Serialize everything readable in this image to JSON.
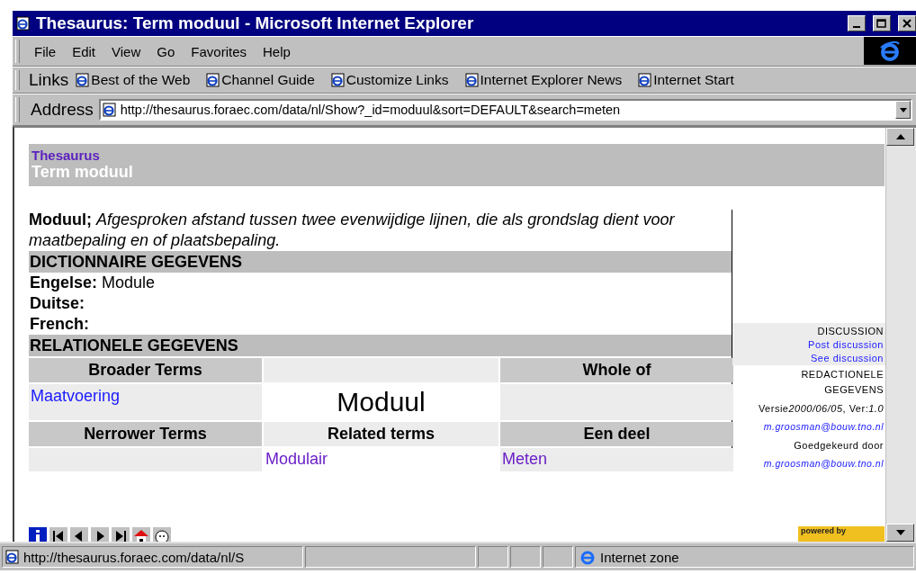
{
  "window": {
    "title": "Thesaurus: Term moduul - Microsoft Internet Explorer"
  },
  "menu": [
    "File",
    "Edit",
    "View",
    "Go",
    "Favorites",
    "Help"
  ],
  "links_bar": {
    "label": "Links",
    "items": [
      "Best of the Web",
      "Channel Guide",
      "Customize Links",
      "Internet Explorer News",
      "Internet Start"
    ]
  },
  "address_bar": {
    "label": "Address",
    "value": "http://thesaurus.foraec.com/data/nl/Show?_id=moduul&sort=DEFAULT&search=meten"
  },
  "page": {
    "header": {
      "section": "Thesaurus",
      "title": "Term moduul"
    },
    "definition": "**Moduul;** *Afgesproken afstand tussen twee evenwijdige lijnen, die als grondslag dient voor maatbepaling en of plaatsbepaling.*",
    "dictionary": {
      "heading": "DICTIONNAIRE GEGEVENS",
      "entries": [
        {
          "label": "Engelse:",
          "value": "Module"
        },
        {
          "label": "Duitse:"
        },
        {
          "label": "French:"
        }
      ]
    },
    "relations": {
      "heading": "RELATIONELE GEGEVENS",
      "broader_heading": "Broader Terms",
      "broader": [
        {
          "text": "Maatvoering",
          "visited": false
        }
      ],
      "whole_of_heading": "Whole of",
      "term": "Moduul",
      "narrower_heading": "Nerrower Terms",
      "related_heading": "Related terms",
      "related": [
        {
          "text": "Modulair",
          "visited": true
        }
      ],
      "part_heading": "Een deel",
      "parts": [
        {
          "text": "Meten",
          "visited": true
        }
      ]
    },
    "sidebar": {
      "discussion_heading": "DISCUSSION",
      "discussion_links": [
        "Post discussion",
        "See discussion"
      ],
      "editorial_heading": "REDACTIONELE GEGEVENS",
      "version": {
        "label": "Versie",
        "date": "2000/06/05",
        "ver_label": ", Ver:",
        "ver": "1.0"
      },
      "author": "m.groosman@bouw.tno.nl",
      "approved_label": "Goedgekeurd door",
      "approver": "m.groosman@bouw.tno.nl"
    },
    "badge": "powered by"
  },
  "status_bar": {
    "url": "http://thesaurus.foraec.com/data/nl/S",
    "zone": "Internet zone"
  }
}
